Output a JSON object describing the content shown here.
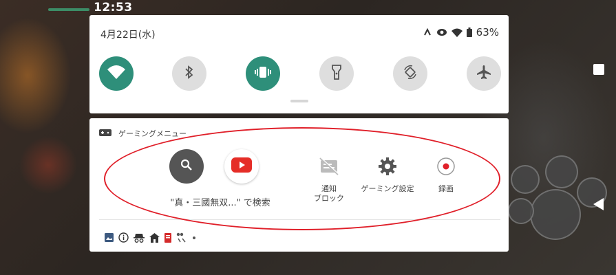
{
  "status_bar": {
    "time": "12:53"
  },
  "quick_settings": {
    "date": "4月22日(水)",
    "battery": "63%",
    "tiles": [
      {
        "name": "wifi",
        "state": "on",
        "icon": "wifi-icon"
      },
      {
        "name": "bluetooth",
        "state": "off",
        "icon": "bluetooth-icon"
      },
      {
        "name": "vibrate",
        "state": "on",
        "icon": "vibrate-icon"
      },
      {
        "name": "flashlight",
        "state": "off",
        "icon": "flashlight-icon"
      },
      {
        "name": "auto-rotate",
        "state": "off",
        "icon": "rotate-icon"
      },
      {
        "name": "airplane-mode",
        "state": "off",
        "icon": "airplane-icon"
      }
    ]
  },
  "gaming_menu": {
    "title": "ゲーミングメニュー",
    "search_label": "\"真・三國無双...\" で検索",
    "actions": {
      "notification_block": "通知\nブロック",
      "gaming_settings": "ゲーミング設定",
      "record": "録画"
    }
  },
  "colors": {
    "tile_on": "#2e8f7a",
    "tile_off": "#dedede",
    "annotation": "#e0202a",
    "youtube_red": "#e52d27"
  }
}
